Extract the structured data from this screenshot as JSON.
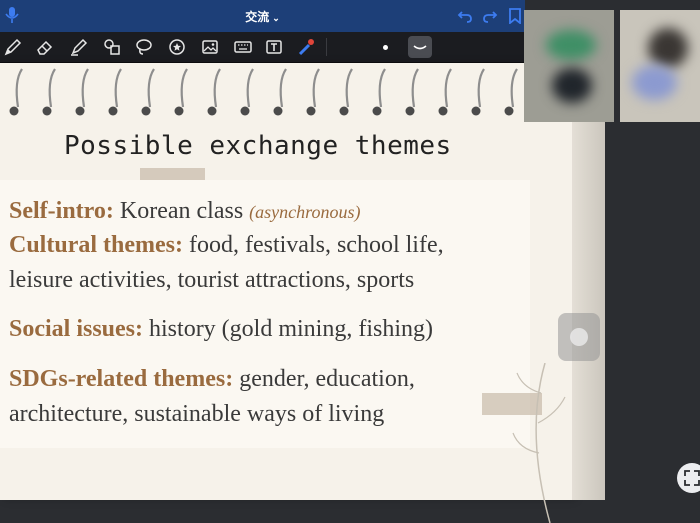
{
  "app": {
    "title": "交流",
    "title_chevron": "⌄"
  },
  "colors": {
    "titlebar": "#1d3f78",
    "toolbar": "#1b1c20",
    "accent": "#3d7cf0",
    "keyword": "#9a6b3f",
    "page": "#f6f2ea"
  },
  "icons": {
    "titlebar": [
      "microphone-icon",
      "undo-icon",
      "redo-icon",
      "bookmark-icon"
    ],
    "toolbar": [
      "pen-icon",
      "eraser-icon",
      "highlighter-icon",
      "shapes-icon",
      "lasso-icon",
      "sticker-icon",
      "image-icon",
      "keyboard-icon",
      "text-icon",
      "laser-pointer-icon"
    ]
  },
  "slide": {
    "heading": "Possible exchange themes",
    "items": [
      {
        "key": "Self-intro:",
        "text": " Korean class ",
        "aside": "(asynchronous)"
      },
      {
        "key": "Cultural themes:",
        "text": " food, festivals, school life,"
      },
      {
        "key": "",
        "text": "leisure activities, tourist attractions, sports"
      },
      {
        "key": "Social issues:",
        "text": " history (gold mining, fishing)"
      },
      {
        "key": "SDGs-related themes:",
        "text": " gender, education,"
      },
      {
        "key": "",
        "text": "architecture, sustainable ways of living"
      }
    ]
  }
}
